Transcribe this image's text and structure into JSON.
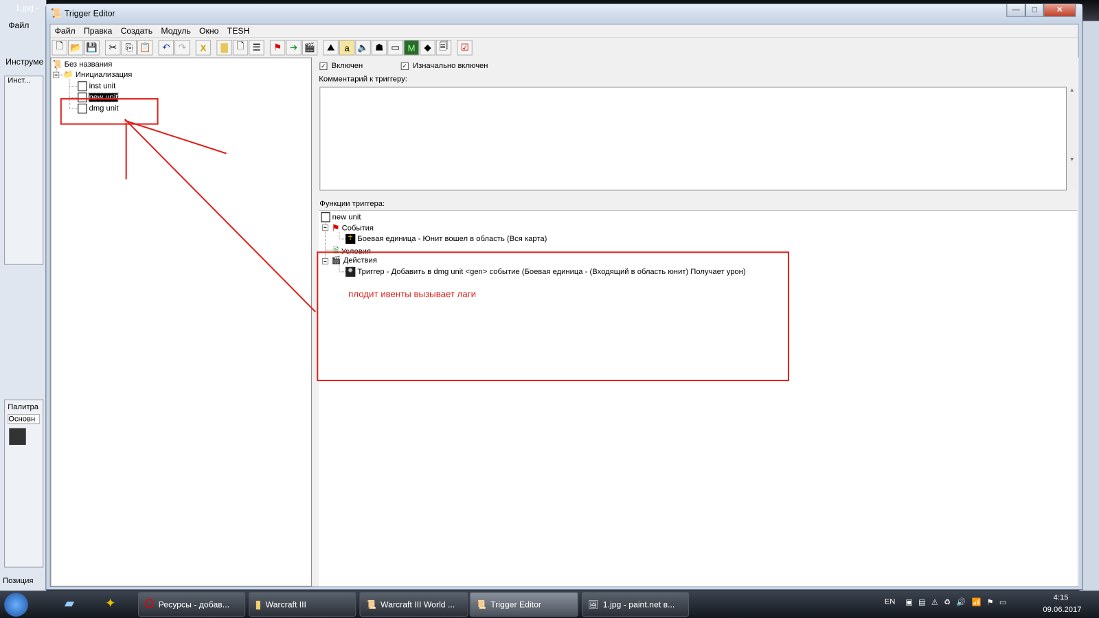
{
  "background": {
    "paint_title": "1.jpg -",
    "paint_menu": "Файл",
    "paint_tools": "Инструме",
    "paint_tools_panel": "Инст...",
    "paint_palette": "Палитра",
    "paint_palette_mode": "Основн",
    "paint_position": "Позиция"
  },
  "window": {
    "title": "Trigger Editor",
    "minimize": "—",
    "maximize": "□",
    "close": "✕"
  },
  "menu": [
    "Файл",
    "Правка",
    "Создать",
    "Модуль",
    "Окно",
    "TESH"
  ],
  "toolbar_icons": [
    "new-icon",
    "open-icon",
    "save-icon",
    "cut-icon",
    "copy-icon",
    "paste-icon",
    "undo-icon",
    "redo-icon",
    "delete-icon",
    "new-category-icon",
    "new-trigger-icon",
    "new-comment-icon",
    "new-event-icon",
    "new-condition-icon",
    "new-action-icon",
    "terrain-editor-icon",
    "unit-editor-icon",
    "sound-editor-icon",
    "object-editor-icon",
    "campaign-editor-icon",
    "ai-editor-icon",
    "object-manager-icon",
    "import-manager-icon",
    "test-map-icon"
  ],
  "tree": {
    "root": "Без названия",
    "category": "Инициализация",
    "triggers": [
      "inst unit",
      "new unit",
      "dmg unit"
    ]
  },
  "trigger": {
    "enabled_label": "Включен",
    "initially_on_label": "Изначально включен",
    "enabled": true,
    "initially_on": true,
    "comment_label": "Комментарий к триггеру:",
    "comment": "",
    "functions_label": "Функции триггера:",
    "name": "new unit",
    "events_label": "События",
    "event": "Боевая единица - Юнит вошел в область (Вся карта)",
    "conditions_label": "Условия",
    "actions_label": "Действия",
    "action": "Триггер - Добавить в dmg unit <gen> событие (Боевая единица - (Входящий в область юнит) Получает урон)"
  },
  "annotation": {
    "text": "плодит ивенты вызывает лаги",
    "color": "#e0201a"
  },
  "taskbar": {
    "items": [
      "Ресурсы - добав...",
      "Warcraft III",
      "Warcraft III World ...",
      "Trigger Editor",
      "1.jpg - paint.net в..."
    ],
    "lang": "EN",
    "time": "4:15",
    "date": "09.06.2017"
  }
}
